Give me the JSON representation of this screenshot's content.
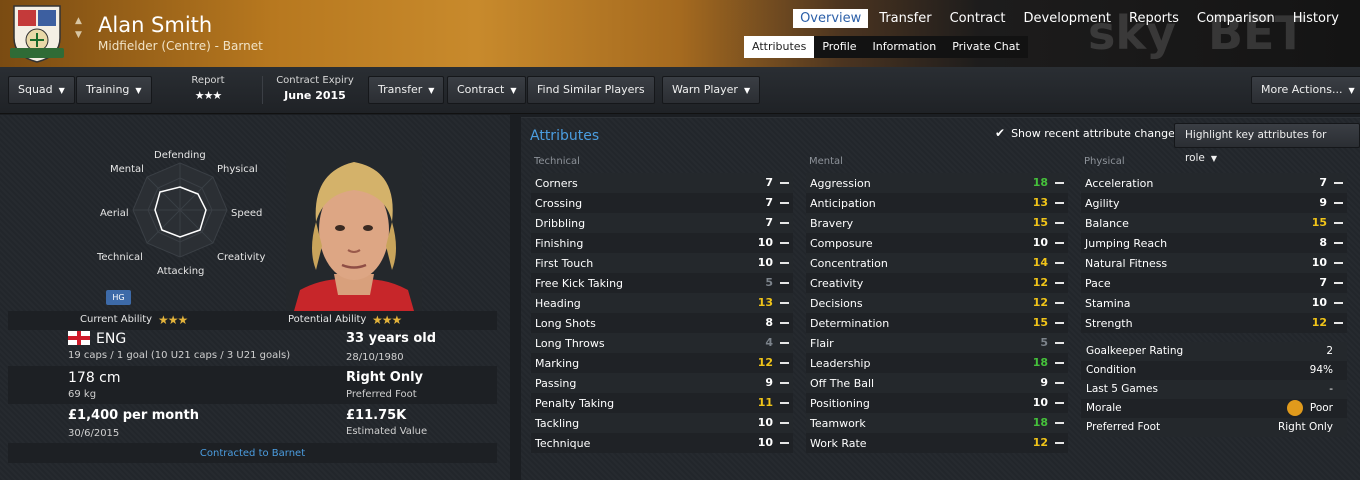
{
  "header": {
    "player_name": "Alan Smith",
    "player_sub": "Midfielder (Centre) - Barnet",
    "sponsor_text": [
      "sky",
      "BET"
    ]
  },
  "nav": {
    "tabs": [
      {
        "label": "Overview",
        "active": true
      },
      {
        "label": "Transfer",
        "active": false
      },
      {
        "label": "Contract",
        "active": false
      },
      {
        "label": "Development",
        "active": false
      },
      {
        "label": "Reports",
        "active": false
      },
      {
        "label": "Comparison",
        "active": false
      },
      {
        "label": "History",
        "active": false
      }
    ],
    "subtabs": [
      {
        "label": "Attributes",
        "active": true
      },
      {
        "label": "Profile",
        "active": false
      },
      {
        "label": "Information",
        "active": false
      },
      {
        "label": "Private Chat",
        "active": false
      }
    ]
  },
  "toolbar": {
    "squad": "Squad",
    "training": "Training",
    "report_label": "Report",
    "report_stars": "★★★",
    "contract_expiry_label": "Contract Expiry",
    "contract_expiry_value": "June 2015",
    "transfer": "Transfer",
    "contract": "Contract",
    "find_similar": "Find Similar Players",
    "warn_player": "Warn Player",
    "more_actions": "More Actions..."
  },
  "radar": {
    "labels": {
      "defending": "Defending",
      "physical": "Physical",
      "speed": "Speed",
      "creativity": "Creativity",
      "attacking": "Attacking",
      "technical": "Technical",
      "aerial": "Aerial",
      "mental": "Mental"
    },
    "badge": "HG"
  },
  "ability": {
    "current_label": "Current Ability",
    "current_stars": "★★★",
    "potential_label": "Potential Ability",
    "potential_stars": "★★★"
  },
  "info": {
    "nation": "ENG",
    "caps": "19 caps / 1 goal (10 U21 caps / 3 U21 goals)",
    "age": "33 years old",
    "dob": "28/10/1980",
    "height": "178 cm",
    "weight": "69 kg",
    "foot": "Right Only",
    "foot_label": "Preferred Foot",
    "wage": "£1,400 per month",
    "contract_end": "30/6/2015",
    "value": "£11.75K",
    "value_label": "Estimated Value",
    "contracted": "Contracted to Barnet"
  },
  "attributes": {
    "title": "Attributes",
    "show_recent": "Show recent attribute changes",
    "highlight": "Highlight key attributes for role",
    "technical_head": "Technical",
    "mental_head": "Mental",
    "physical_head": "Physical",
    "technical": [
      {
        "name": "Corners",
        "value": "7",
        "tone": "white"
      },
      {
        "name": "Crossing",
        "value": "7",
        "tone": "white"
      },
      {
        "name": "Dribbling",
        "value": "7",
        "tone": "white"
      },
      {
        "name": "Finishing",
        "value": "10",
        "tone": "white"
      },
      {
        "name": "First Touch",
        "value": "10",
        "tone": "white"
      },
      {
        "name": "Free Kick Taking",
        "value": "5",
        "tone": "grey"
      },
      {
        "name": "Heading",
        "value": "13",
        "tone": "yellow"
      },
      {
        "name": "Long Shots",
        "value": "8",
        "tone": "white"
      },
      {
        "name": "Long Throws",
        "value": "4",
        "tone": "grey"
      },
      {
        "name": "Marking",
        "value": "12",
        "tone": "yellow"
      },
      {
        "name": "Passing",
        "value": "9",
        "tone": "white"
      },
      {
        "name": "Penalty Taking",
        "value": "11",
        "tone": "yellow"
      },
      {
        "name": "Tackling",
        "value": "10",
        "tone": "white"
      },
      {
        "name": "Technique",
        "value": "10",
        "tone": "white"
      }
    ],
    "mental": [
      {
        "name": "Aggression",
        "value": "18",
        "tone": "green"
      },
      {
        "name": "Anticipation",
        "value": "13",
        "tone": "yellow"
      },
      {
        "name": "Bravery",
        "value": "15",
        "tone": "yellow"
      },
      {
        "name": "Composure",
        "value": "10",
        "tone": "white"
      },
      {
        "name": "Concentration",
        "value": "14",
        "tone": "yellow"
      },
      {
        "name": "Creativity",
        "value": "12",
        "tone": "yellow"
      },
      {
        "name": "Decisions",
        "value": "12",
        "tone": "yellow"
      },
      {
        "name": "Determination",
        "value": "15",
        "tone": "yellow"
      },
      {
        "name": "Flair",
        "value": "5",
        "tone": "grey"
      },
      {
        "name": "Leadership",
        "value": "18",
        "tone": "green"
      },
      {
        "name": "Off The Ball",
        "value": "9",
        "tone": "white"
      },
      {
        "name": "Positioning",
        "value": "10",
        "tone": "white"
      },
      {
        "name": "Teamwork",
        "value": "18",
        "tone": "green"
      },
      {
        "name": "Work Rate",
        "value": "12",
        "tone": "yellow"
      }
    ],
    "physical": [
      {
        "name": "Acceleration",
        "value": "7",
        "tone": "white"
      },
      {
        "name": "Agility",
        "value": "9",
        "tone": "white"
      },
      {
        "name": "Balance",
        "value": "15",
        "tone": "yellow"
      },
      {
        "name": "Jumping Reach",
        "value": "8",
        "tone": "white"
      },
      {
        "name": "Natural Fitness",
        "value": "10",
        "tone": "white"
      },
      {
        "name": "Pace",
        "value": "7",
        "tone": "white"
      },
      {
        "name": "Stamina",
        "value": "10",
        "tone": "white"
      },
      {
        "name": "Strength",
        "value": "12",
        "tone": "yellow"
      }
    ],
    "extra": [
      {
        "name": "Goalkeeper Rating",
        "value": "2"
      },
      {
        "name": "Condition",
        "value": "94%"
      },
      {
        "name": "Last 5 Games",
        "value": "-"
      },
      {
        "name": "Morale",
        "value": "Poor"
      },
      {
        "name": "Preferred Foot",
        "value": "Right Only"
      }
    ]
  }
}
